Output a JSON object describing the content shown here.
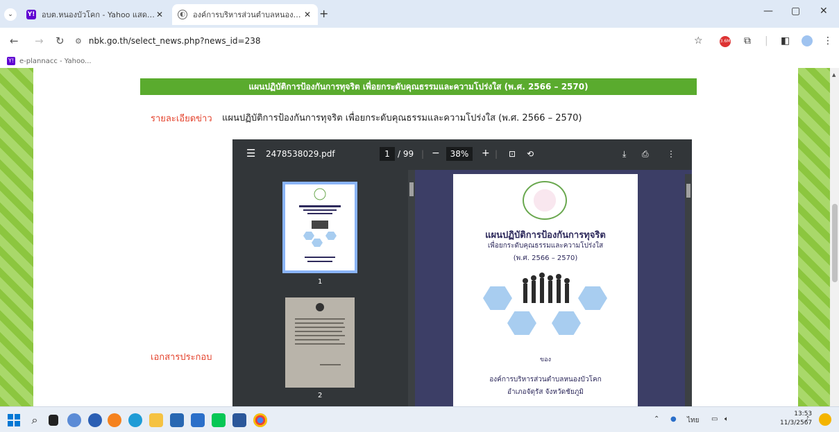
{
  "browser": {
    "tabs": [
      {
        "title": "อบต.หนองบัวโคก - Yahoo แสดงผ...",
        "active": false
      },
      {
        "title": "องค์การบริหารส่วนตำบลหนองบัวโคก",
        "active": true
      }
    ],
    "new_tab_label": "+",
    "url": "nbk.go.th/select_news.php?news_id=238",
    "extension_badge": "3.6M",
    "bookmark": "e-plannacc - Yahoo..."
  },
  "window": {
    "minimize": "—",
    "maximize": "▢",
    "close": "✕"
  },
  "page": {
    "header_title": "แผนปฏิบัติการป้องกันการทุจริต เพื่อยกระดับคุณธรรมและความโปร่งใส (พ.ศ. 2566 – 2570)",
    "detail_label": "รายละเอียดข่าว",
    "detail_text": "แผนปฏิบัติการป้องกันการทุจริต เพื่อยกระดับคุณธรรมและความโปร่งใส (พ.ศ. 2566 – 2570)",
    "attachment_label": "เอกสารประกอบ"
  },
  "pdf": {
    "filename": "2478538029.pdf",
    "current_page": "1",
    "total_pages": "/ 99",
    "zoom": "38%",
    "thumb_labels": [
      "1",
      "2"
    ],
    "doc_title": "แผนปฏิบัติการป้องกันการทุจริต",
    "doc_subtitle": "เพื่อยกระดับคุณธรรมและความโปร่งใส",
    "doc_years": "(พ.ศ. 2566 – 2570)",
    "doc_of": "ของ",
    "doc_org": "องค์การบริหารส่วนตำบลหนองบัวโคก",
    "doc_location": "อำเภอจัตุรัส  จังหวัดชัยภูมิ"
  },
  "taskbar": {
    "tray_lang": "ไทย",
    "time": "13:53",
    "date": "11/3/2567"
  }
}
